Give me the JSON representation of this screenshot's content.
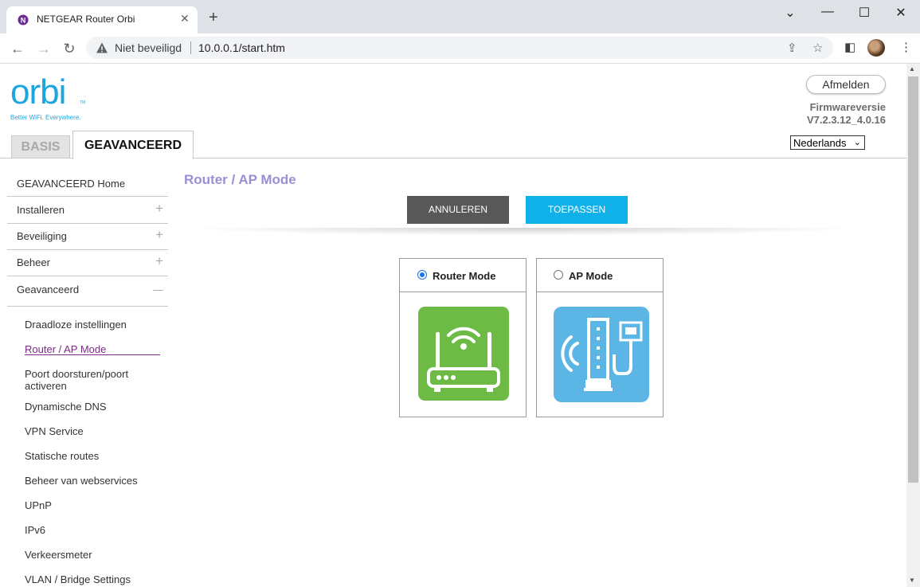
{
  "browser": {
    "tab_title": "NETGEAR Router Orbi",
    "insecure_label": "Niet beveiligd",
    "url": "10.0.0.1/start.htm"
  },
  "header": {
    "logo_text": "orbi",
    "logo_tm": "TM",
    "tagline": "Better WiFi. Everywhere.",
    "tab_basic": "BASIS",
    "tab_advanced": "GEAVANCEERD",
    "logout_label": "Afmelden",
    "firmware_label": "Firmwareversie",
    "firmware_version": "V7.2.3.12_4.0.16",
    "language": "Nederlands"
  },
  "sidebar": {
    "items": [
      {
        "label": "GEAVANCEERD Home",
        "expand": ""
      },
      {
        "label": "Installeren",
        "expand": "+"
      },
      {
        "label": "Beveiliging",
        "expand": "+"
      },
      {
        "label": "Beheer",
        "expand": "+"
      },
      {
        "label": "Geavanceerd",
        "expand": "—"
      }
    ],
    "subitems": [
      "Draadloze instellingen",
      "Router / AP Mode",
      "Poort doorsturen/poort activeren",
      "Dynamische DNS",
      "VPN Service",
      "Statische routes",
      "Beheer van webservices",
      "UPnP",
      "IPv6",
      "Verkeersmeter",
      "VLAN / Bridge Settings"
    ]
  },
  "main": {
    "title": "Router / AP Mode",
    "cancel_label": "ANNULEREN",
    "apply_label": "TOEPASSEN",
    "modes": [
      {
        "label": "Router Mode",
        "selected": true,
        "color": "#6dbb45"
      },
      {
        "label": "AP Mode",
        "selected": false,
        "color": "#5bb6e6"
      }
    ]
  }
}
